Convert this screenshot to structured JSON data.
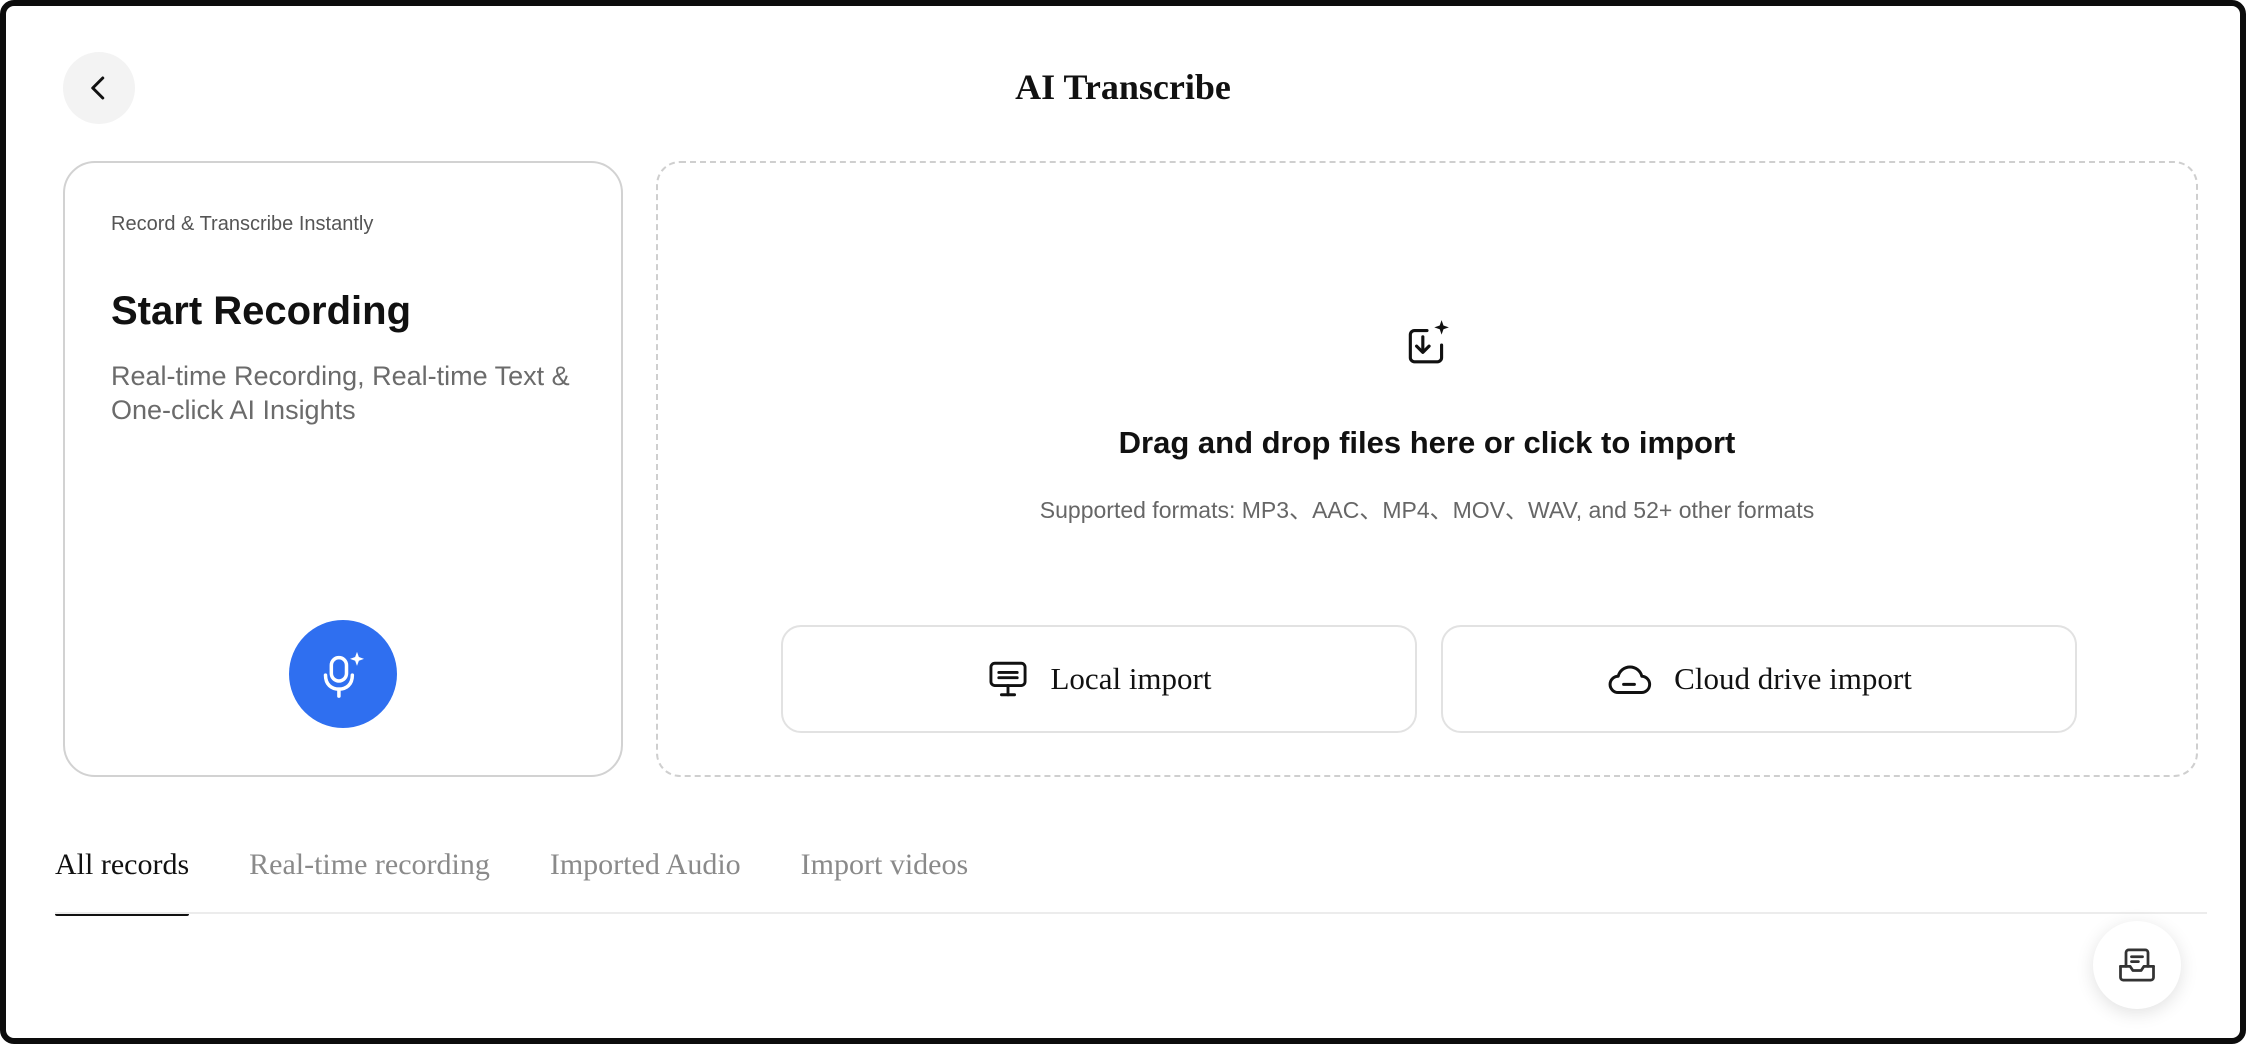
{
  "header": {
    "title": "AI Transcribe",
    "back_icon": "chevron-left-icon"
  },
  "record_card": {
    "kicker": "Record & Transcribe Instantly",
    "title": "Start Recording",
    "description": "Real-time Recording, Real-time Text & One-click AI Insights",
    "button_icon": "mic-sparkle-icon",
    "accent_color": "#2f6ff0"
  },
  "drop_zone": {
    "icon": "import-sparkle-icon",
    "title": "Drag and drop files here or click to import",
    "subtitle": "Supported formats: MP3、AAC、MP4、MOV、WAV, and 52+ other formats",
    "local_button": {
      "label": "Local import",
      "icon": "monitor-icon"
    },
    "cloud_button": {
      "label": "Cloud drive import",
      "icon": "cloud-icon"
    }
  },
  "tabs": [
    {
      "label": "All records",
      "active": true
    },
    {
      "label": "Real-time recording",
      "active": false
    },
    {
      "label": "Imported Audio",
      "active": false
    },
    {
      "label": "Import videos",
      "active": false
    }
  ],
  "fab": {
    "icon": "inbox-icon"
  }
}
